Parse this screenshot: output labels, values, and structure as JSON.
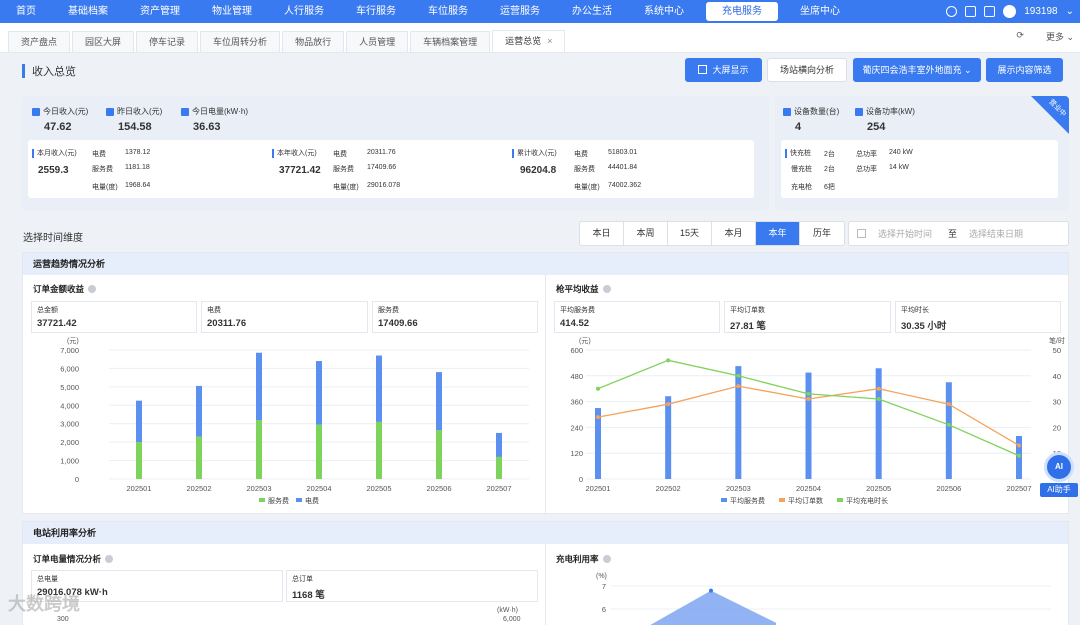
{
  "topnav": {
    "items": [
      "首页",
      "基础档案",
      "资产管理",
      "物业管理",
      "人行服务",
      "车行服务",
      "车位服务",
      "运营服务",
      "办公生活",
      "系统中心",
      "充电服务",
      "坐席中心"
    ],
    "active_index": 10,
    "user": "193198"
  },
  "tabs": {
    "items": [
      "资产盘点",
      "园区大屏",
      "停车记录",
      "车位周转分析",
      "物品放行",
      "人员管理",
      "车辆档案管理",
      "运营总览"
    ],
    "active_index": 7,
    "close_symbol": "×",
    "more_label": "更多"
  },
  "header": {
    "title": "收入总览",
    "btn_bigscreen": "大屏显示",
    "btn_station": "场站横向分析",
    "btn_dropdown": "葡庆四会浩丰室外地面充",
    "btn_filter": "展示内容筛选"
  },
  "summary": {
    "today_income_label": "今日收入(元)",
    "today_income": "47.62",
    "yesterday_income_label": "昨日收入(元)",
    "yesterday_income": "154.58",
    "today_power_label": "今日电量(kW·h)",
    "today_power": "36.63",
    "month": {
      "label": "本月收入(元)",
      "value": "2559.3",
      "elec_label": "电费",
      "elec": "1378.12",
      "service_label": "服务费",
      "service": "1181.18",
      "qty_label": "电量(度)",
      "qty": "1968.64"
    },
    "year": {
      "label": "本年收入(元)",
      "value": "37721.42",
      "elec_label": "电费",
      "elec": "20311.76",
      "service_label": "服务费",
      "service": "17409.66",
      "qty_label": "电量(度)",
      "qty": "29016.078"
    },
    "total": {
      "label": "累计收入(元)",
      "value": "96204.8",
      "elec_label": "电费",
      "elec": "51803.01",
      "service_label": "服务费",
      "service": "44401.84",
      "qty_label": "电量(度)",
      "qty": "74002.362"
    }
  },
  "device": {
    "count_label": "设备数量(台)",
    "count": "4",
    "power_label": "设备功率(kW)",
    "power": "254",
    "badge": "营业中",
    "fast_label": "快充桩",
    "fast_count": "2台",
    "fast_power_label": "总功率",
    "fast_power": "240 kW",
    "slow_label": "慢充桩",
    "slow_count": "2台",
    "slow_power_label": "总功率",
    "slow_power": "14 kW",
    "gun_label": "充电枪",
    "gun_count": "6把"
  },
  "time_dim": {
    "label": "选择时间维度",
    "options": [
      "本日",
      "本周",
      "15天",
      "本月",
      "本年",
      "历年"
    ],
    "active_index": 4,
    "start_placeholder": "选择开始时间",
    "to": "至",
    "end_placeholder": "选择结束日期"
  },
  "trend": {
    "section_title": "运营趋势情况分析",
    "order_title": "订单金额收益",
    "order_metrics": [
      {
        "label": "总金额",
        "value": "37721.42"
      },
      {
        "label": "电费",
        "value": "20311.76"
      },
      {
        "label": "服务费",
        "value": "17409.66"
      }
    ],
    "gun_title": "枪平均收益",
    "gun_metrics": [
      {
        "label": "平均服务费",
        "value": "414.52"
      },
      {
        "label": "平均订单数",
        "value": "27.81 笔"
      },
      {
        "label": "平均时长",
        "value": "30.35 小时"
      }
    ]
  },
  "util": {
    "section_title": "电站利用率分析",
    "order_power_title": "订单电量情况分析",
    "total_power_label": "总电量",
    "total_power": "29016.078 kW·h",
    "total_orders_label": "总订单",
    "total_orders": "1168 笔",
    "left_unit": "(kW·h)",
    "left_tick": "300",
    "right_tick": "6,000",
    "rate_title": "充电利用率",
    "rate_unit": "(%)"
  },
  "ai": {
    "label": "AI助手",
    "icon_text": "AI"
  },
  "watermark": "大数跨境",
  "colors": {
    "primary": "#3a7af0",
    "service": "#7ed35a",
    "elec": "#5b8ff0",
    "orders": "#f5a35c"
  },
  "chart_data": [
    {
      "type": "bar",
      "title": "订单金额收益",
      "stacked": true,
      "ylabel": "(元)",
      "ylim": [
        0,
        7000
      ],
      "yticks": [
        0,
        1000,
        2000,
        3000,
        4000,
        5000,
        6000,
        7000
      ],
      "ytick_labels": [
        "0",
        "1,000",
        "2,000",
        "3,000",
        "4,000",
        "5,000",
        "6,000",
        "7,000"
      ],
      "categories": [
        "202501",
        "202502",
        "202503",
        "202504",
        "202505",
        "202506",
        "202507"
      ],
      "series": [
        {
          "name": "服务费",
          "values": [
            2000,
            2300,
            3200,
            2950,
            3100,
            2650,
            1200
          ]
        },
        {
          "name": "电费",
          "values": [
            2250,
            2750,
            3650,
            3450,
            3600,
            3150,
            1300
          ]
        }
      ],
      "legend": "bottom"
    },
    {
      "type": "bar+line",
      "title": "枪平均收益",
      "ylabel_left": "(元)",
      "ylabel_right": "笔/时",
      "ylim_left": [
        0,
        600
      ],
      "yticks_left": [
        0,
        120,
        240,
        360,
        480,
        600
      ],
      "ylim_right": [
        0,
        50
      ],
      "yticks_right": [
        0,
        10,
        20,
        30,
        40,
        50
      ],
      "categories": [
        "202501",
        "202502",
        "202503",
        "202504",
        "202505",
        "202506",
        "202507"
      ],
      "series": [
        {
          "name": "平均服务费",
          "kind": "bar",
          "axis": "left",
          "values": [
            330,
            385,
            525,
            495,
            515,
            450,
            200
          ]
        },
        {
          "name": "平均订单数",
          "kind": "line",
          "axis": "right",
          "values": [
            24,
            29,
            36,
            31,
            35,
            29,
            13
          ]
        },
        {
          "name": "平均充电时长",
          "kind": "line",
          "axis": "right",
          "values": [
            35,
            46,
            40,
            33,
            31,
            21,
            9
          ]
        }
      ],
      "legend": "bottom"
    },
    {
      "type": "area",
      "title": "充电利用率",
      "ylabel": "(%)",
      "yticks": [
        6,
        7
      ],
      "series": [
        {
          "values": [
            5.2,
            6.8,
            5.4
          ]
        }
      ]
    }
  ]
}
